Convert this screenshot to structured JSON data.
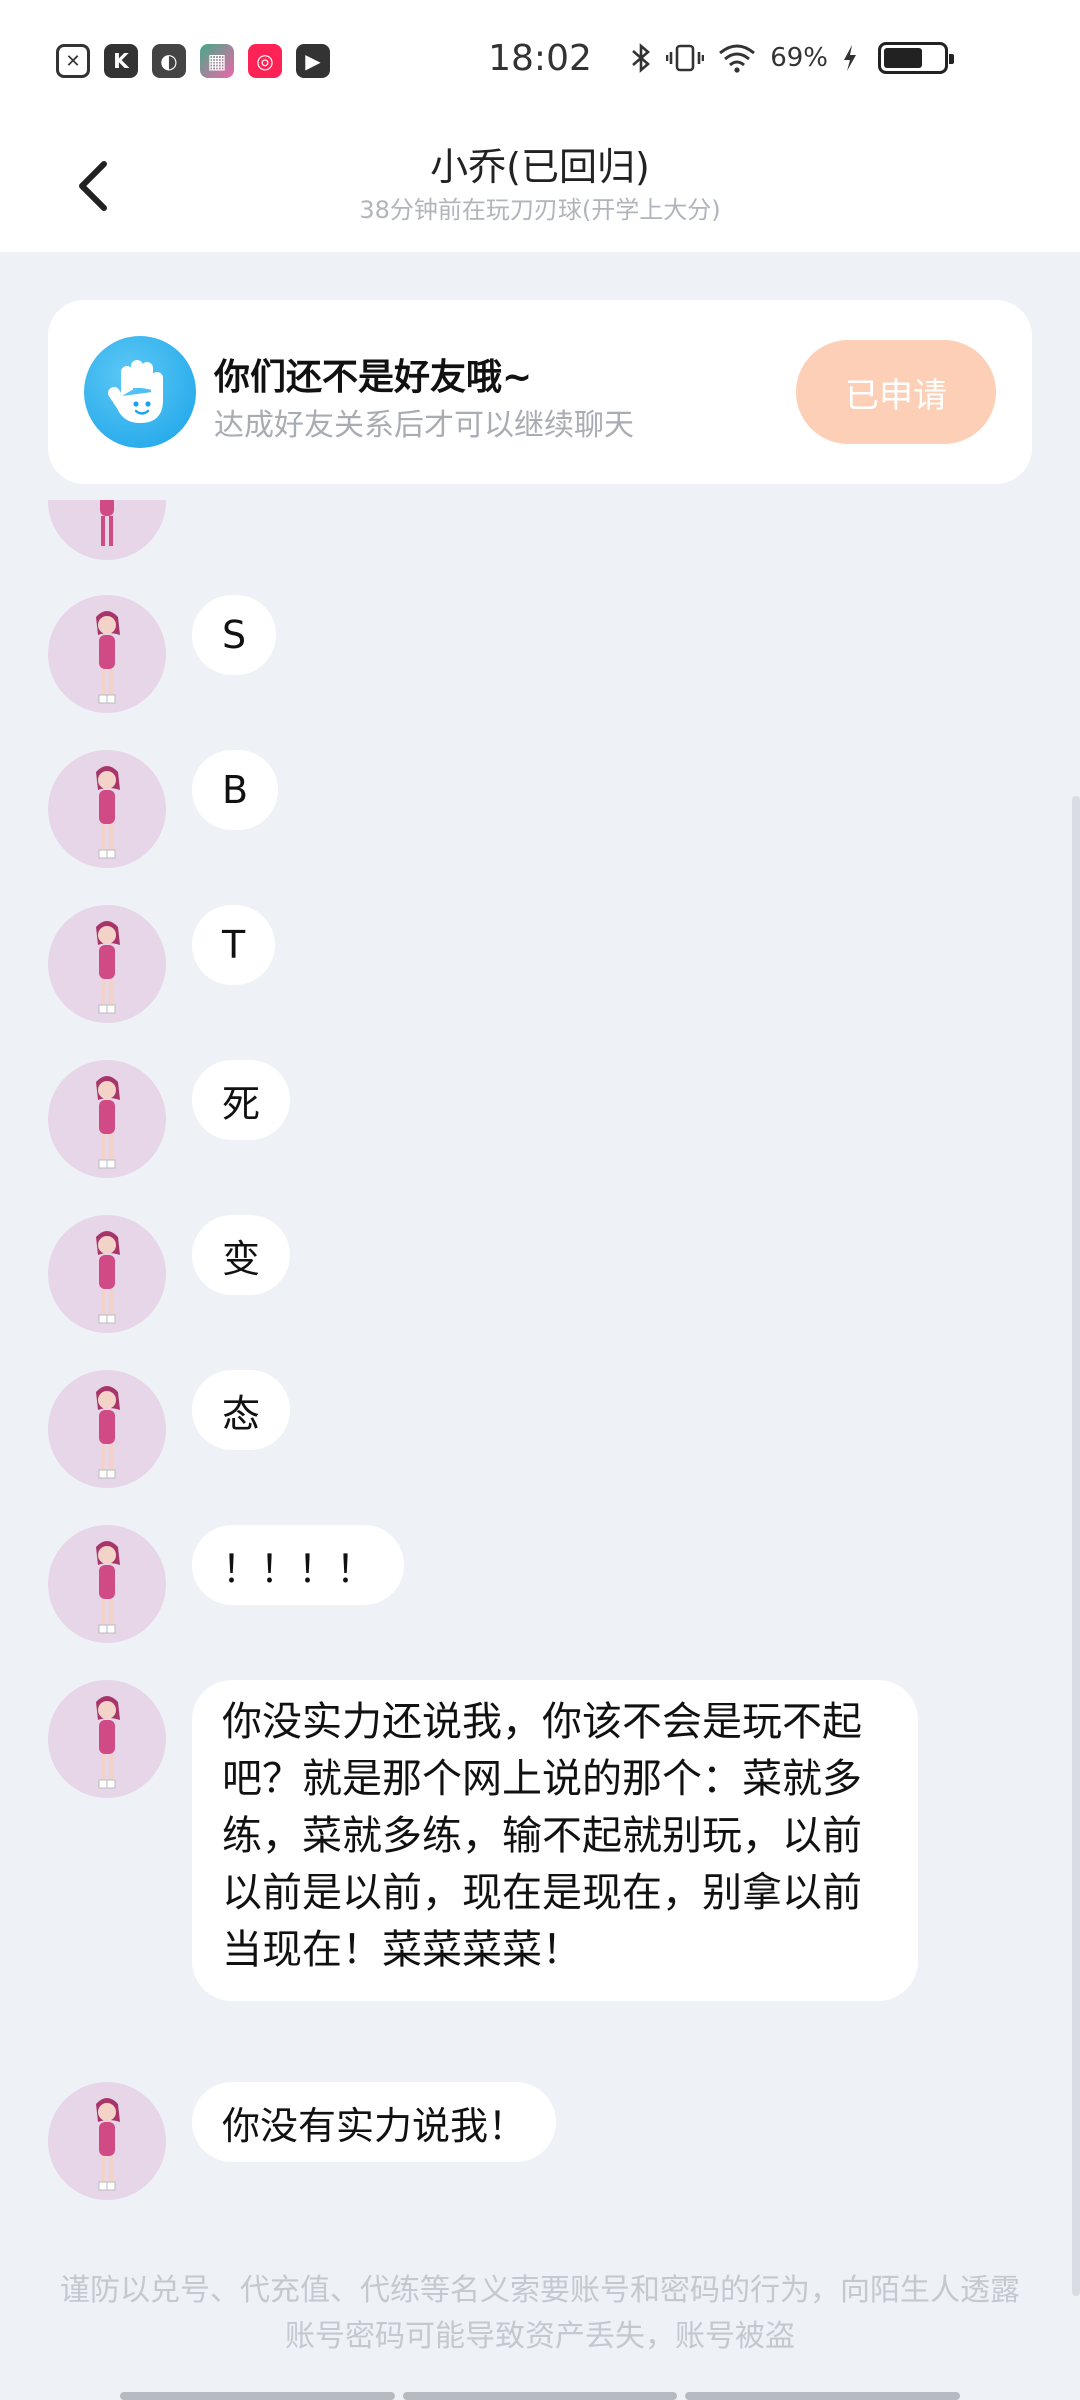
{
  "status_bar": {
    "time": "18:02",
    "battery_percent": "69%",
    "battery_level": 0.69,
    "left_app_icons": [
      "notification-x-icon",
      "k-app-icon",
      "leaf-app-icon",
      "game-app-icon",
      "kuaishou-app-icon",
      "video-app-icon"
    ]
  },
  "header": {
    "title": "小乔(已回归)",
    "subtitle": "38分钟前在玩刀刃球(开学上大分)",
    "back_icon": "chevron-left-icon"
  },
  "friend_card": {
    "title": "你们还不是好友哦~",
    "subtitle": "达成好友关系后才可以继续聊天",
    "button_label": "已申请",
    "accent_color": "#fccfb6",
    "icon_color": "#1aa3e8"
  },
  "messages": [
    {
      "text": "S"
    },
    {
      "text": "B"
    },
    {
      "text": "T"
    },
    {
      "text": "死"
    },
    {
      "text": "变"
    },
    {
      "text": "态"
    },
    {
      "text": "！！！！"
    },
    {
      "text": "你没实力还说我，你该不会是玩不起吧？就是那个网上说的那个：菜就多练，菜就多练，输不起就别玩，以前以前是以前，现在是现在，别拿以前当现在！菜菜菜菜！"
    },
    {
      "text": "你没有实力说我！"
    }
  ],
  "warning": "谨防以兑号、代充值、代练等名义索要账号和密码的行为，向陌生人透露账号密码可能导致资产丢失，账号被盗"
}
